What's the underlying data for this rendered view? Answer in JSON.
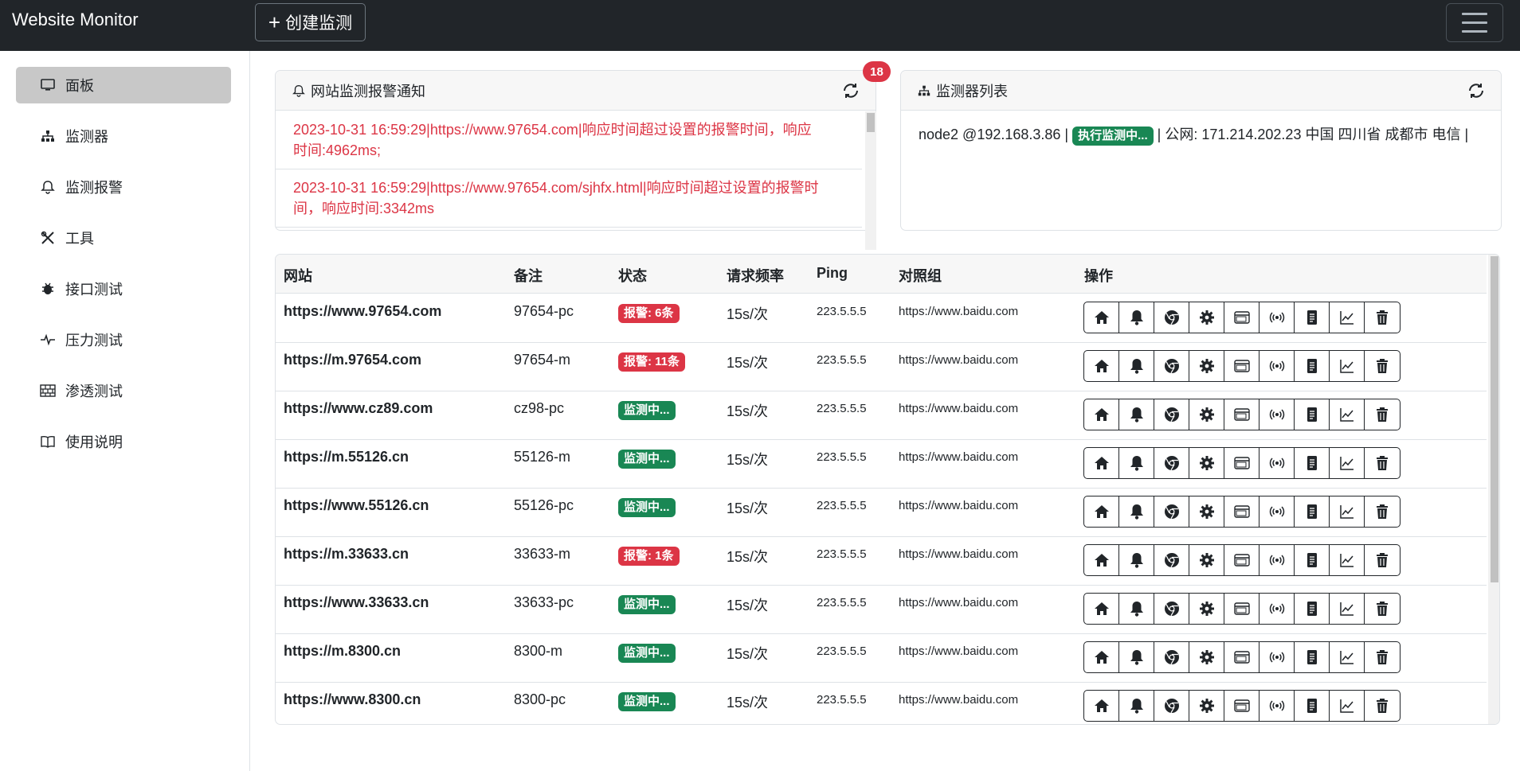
{
  "app": {
    "brand": "Website Monitor",
    "create_button": "创建监测"
  },
  "sidebar": {
    "items": [
      {
        "label": "面板",
        "icon": "monitor-icon",
        "active": true
      },
      {
        "label": "监测器",
        "icon": "sitemap-icon"
      },
      {
        "label": "监测报警",
        "icon": "bell-icon"
      },
      {
        "label": "工具",
        "icon": "tools-icon"
      },
      {
        "label": "接口测试",
        "icon": "bug-icon"
      },
      {
        "label": "压力测试",
        "icon": "pulse-icon"
      },
      {
        "label": "渗透测试",
        "icon": "bricks-icon"
      },
      {
        "label": "使用说明",
        "icon": "book-icon"
      }
    ]
  },
  "alerts": {
    "title": "网站监测报警通知",
    "count": "18",
    "items": [
      "2023-10-31 16:59:29|https://www.97654.com|响应时间超过设置的报警时间，响应时间:4962ms;",
      "2023-10-31 16:59:29|https://www.97654.com/sjhfx.html|响应时间超过设置的报警时间，响应时间:3342ms"
    ]
  },
  "monitors": {
    "title": "监测器列表",
    "node": "node2 @192.168.3.86 |",
    "status": "执行监测中...",
    "info": "| 公网: 171.214.202.23 中国 四川省 成都市 电信 |"
  },
  "table": {
    "headers": [
      "网站",
      "备注",
      "状态",
      "请求频率",
      "Ping",
      "对照组",
      "操作"
    ],
    "rows": [
      {
        "site": "https://www.97654.com",
        "note": "97654-pc",
        "status": "报警: 6条",
        "status_type": "red",
        "freq": "15s/次",
        "ping": "223.5.5.5",
        "ref": "https://www.baidu.com"
      },
      {
        "site": "https://m.97654.com",
        "note": "97654-m",
        "status": "报警: 11条",
        "status_type": "red",
        "freq": "15s/次",
        "ping": "223.5.5.5",
        "ref": "https://www.baidu.com"
      },
      {
        "site": "https://www.cz89.com",
        "note": "cz98-pc",
        "status": "监测中...",
        "status_type": "green",
        "freq": "15s/次",
        "ping": "223.5.5.5",
        "ref": "https://www.baidu.com"
      },
      {
        "site": "https://m.55126.cn",
        "note": "55126-m",
        "status": "监测中...",
        "status_type": "green",
        "freq": "15s/次",
        "ping": "223.5.5.5",
        "ref": "https://www.baidu.com"
      },
      {
        "site": "https://www.55126.cn",
        "note": "55126-pc",
        "status": "监测中...",
        "status_type": "green",
        "freq": "15s/次",
        "ping": "223.5.5.5",
        "ref": "https://www.baidu.com"
      },
      {
        "site": "https://m.33633.cn",
        "note": "33633-m",
        "status": "报警: 1条",
        "status_type": "red",
        "freq": "15s/次",
        "ping": "223.5.5.5",
        "ref": "https://www.baidu.com"
      },
      {
        "site": "https://www.33633.cn",
        "note": "33633-pc",
        "status": "监测中...",
        "status_type": "green",
        "freq": "15s/次",
        "ping": "223.5.5.5",
        "ref": "https://www.baidu.com"
      },
      {
        "site": "https://m.8300.cn",
        "note": "8300-m",
        "status": "监测中...",
        "status_type": "green",
        "freq": "15s/次",
        "ping": "223.5.5.5",
        "ref": "https://www.baidu.com"
      },
      {
        "site": "https://www.8300.cn",
        "note": "8300-pc",
        "status": "监测中...",
        "status_type": "green",
        "freq": "15s/次",
        "ping": "223.5.5.5",
        "ref": "https://www.baidu.com"
      }
    ],
    "actions": [
      "home-icon",
      "bell-icon",
      "chrome-icon",
      "gear-icon",
      "window-icon",
      "broadcast-icon",
      "document-icon",
      "graph-icon",
      "trash-icon"
    ]
  },
  "colors": {
    "navbar": "#212529",
    "danger": "#dc3545",
    "success": "#198754"
  }
}
